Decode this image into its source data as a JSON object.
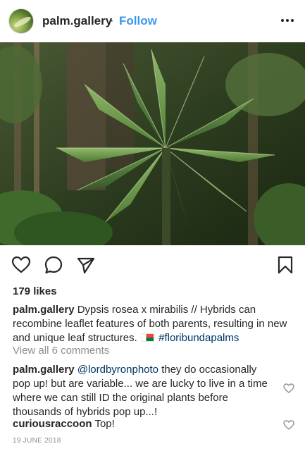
{
  "header": {
    "username": "palm.gallery",
    "separator": "·",
    "follow_label": "Follow",
    "more_icon": "more-horizontal-icon"
  },
  "post": {
    "image_subject": "fan-shaped palm fronds in a dense tropical garden",
    "likes": "179 likes",
    "caption": {
      "user": "palm.gallery",
      "text": "Dypsis rosea x mirabilis // Hybrids can recombine leaflet features of both parents, resulting in new and unique leaf structures.",
      "flag_icon": "madagascar-flag-icon",
      "hashtag": "#floribundapalms"
    },
    "view_all_comments": "View all 6 comments",
    "comments": [
      {
        "user": "palm.gallery",
        "mention": "@lordbyronphoto",
        "text": "they do occasionally pop up! but are variable... we are lucky to live in a time where we can still ID the original plants before thousands of hybrids pop up...!"
      },
      {
        "user": "curiousraccoon",
        "mention": "",
        "text": "Top!"
      }
    ],
    "date": "19 JUNE 2018"
  },
  "actions": {
    "like_icon": "heart-icon",
    "comment_icon": "comment-icon",
    "share_icon": "send-icon",
    "save_icon": "bookmark-icon"
  },
  "colors": {
    "link_blue": "#3897f0",
    "hashtag_blue": "#003569",
    "muted_gray": "#8e8e8e",
    "text": "#262626"
  }
}
